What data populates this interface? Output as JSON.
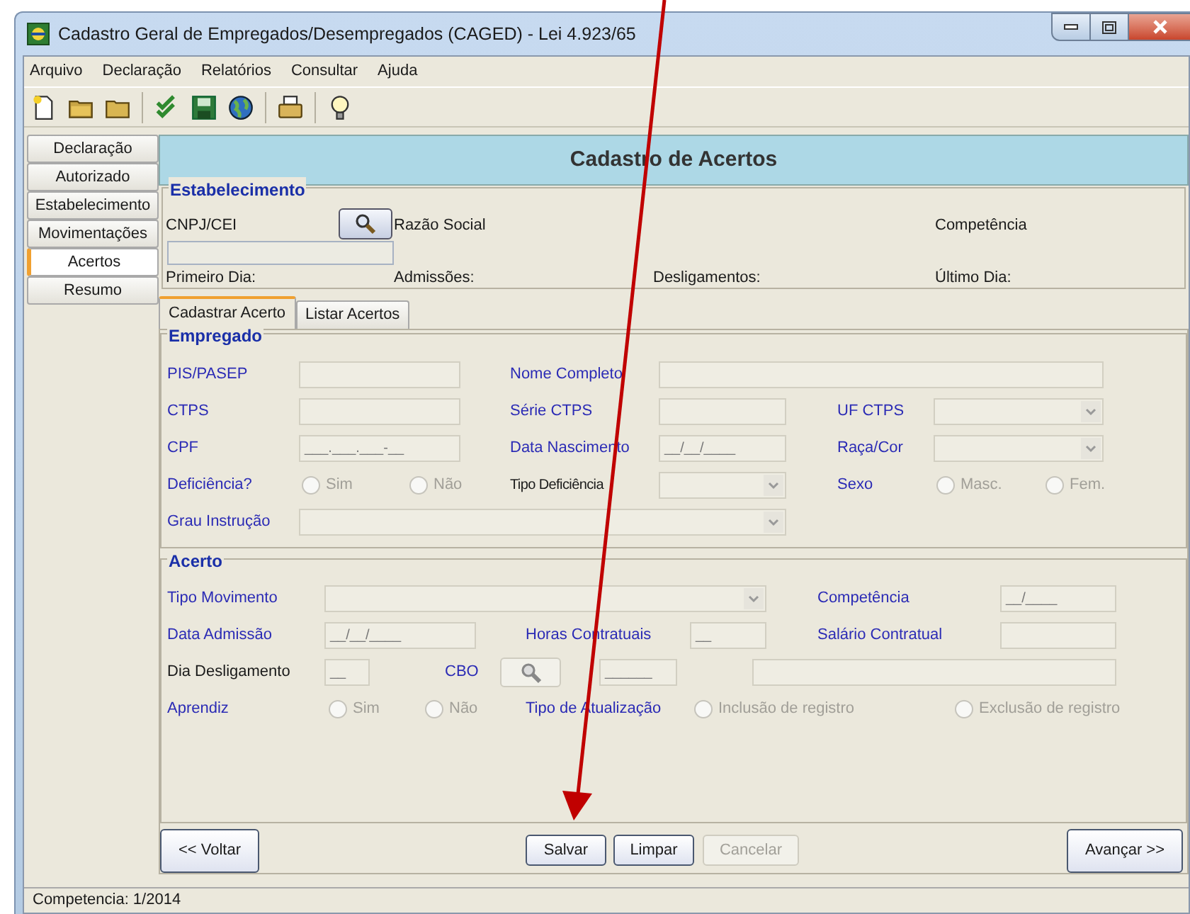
{
  "window": {
    "title": "Cadastro Geral de Empregados/Desempregados (CAGED) - Lei 4.923/65"
  },
  "menu": [
    "Arquivo",
    "Declaração",
    "Relatórios",
    "Consultar",
    "Ajuda"
  ],
  "sidebar": {
    "items": [
      {
        "label": "Declaração",
        "selected": false
      },
      {
        "label": "Autorizado",
        "selected": false
      },
      {
        "label": "Estabelecimento",
        "selected": false
      },
      {
        "label": "Movimentações",
        "selected": false
      },
      {
        "label": "Acertos",
        "selected": true
      },
      {
        "label": "Resumo",
        "selected": false
      }
    ]
  },
  "panel": {
    "title": "Cadastro de Acertos"
  },
  "estabelecimento": {
    "legend": "Estabelecimento",
    "cnpj_label": "CNPJ/CEI",
    "razao_social_label": "Razão Social",
    "competencia_label": "Competência",
    "primeiro_dia_label": "Primeiro Dia:",
    "admissoes_label": "Admissões:",
    "desligamentos_label": "Desligamentos:",
    "ultimo_dia_label": "Último Dia:"
  },
  "tabs": [
    {
      "label": "Cadastrar Acerto",
      "selected": true
    },
    {
      "label": "Listar Acertos",
      "selected": false
    }
  ],
  "empregado": {
    "legend": "Empregado",
    "lines": [
      {
        "fields": [
          {
            "label": "PIS/PASEP",
            "color": "#2b2bb5",
            "kind": "text"
          },
          {
            "label": "Nome Completo",
            "color": "#2b2bb5",
            "kind": "text"
          }
        ]
      },
      {
        "fields": [
          {
            "label": "CTPS",
            "color": "#2b2bb5",
            "kind": "text"
          },
          {
            "label": "Série CTPS",
            "color": "#2b2bb5",
            "kind": "text"
          },
          {
            "label": "UF CTPS",
            "color": "#2b2bb5",
            "kind": "combo"
          }
        ]
      },
      {
        "fields": [
          {
            "label": "CPF",
            "color": "#2b2bb5",
            "kind": "text",
            "value": "___.___.___-__"
          },
          {
            "label": "Data Nascimento",
            "color": "#2b2bb5",
            "kind": "text",
            "value": "__/__/____"
          },
          {
            "label": "Raça/Cor",
            "color": "#2b2bb5",
            "kind": "combo"
          }
        ]
      },
      {
        "fields": [
          {
            "label": "Deficiência?",
            "color": "#2b2bb5",
            "kind": "radio",
            "options": [
              {
                "text": "Sim",
                "checked": false
              },
              {
                "text": "Não",
                "checked": false
              }
            ]
          },
          {
            "label": "Tipo Deficiência",
            "color": "#1a1a1a",
            "kind": "combo"
          },
          {
            "label": "Sexo",
            "color": "#2b2bb5",
            "kind": "radio",
            "options": [
              {
                "text": "Masc.",
                "checked": false
              },
              {
                "text": "Fem.",
                "checked": false
              }
            ]
          }
        ]
      },
      {
        "fields": [
          {
            "label": "Grau Instrução",
            "color": "#2b2bb5",
            "kind": "combo"
          }
        ]
      }
    ]
  },
  "acerto": {
    "legend": "Acerto",
    "lines": [
      {
        "fields": [
          {
            "label": "Tipo Movimento",
            "color": "#2b2bb5",
            "kind": "combo"
          },
          {
            "label": "Competência",
            "color": "#2b2bb5",
            "kind": "text",
            "value": "__/____"
          }
        ]
      },
      {
        "fields": [
          {
            "label": "Data Admissão",
            "color": "#2b2bb5",
            "kind": "text",
            "value": "__/__/____"
          },
          {
            "label": "Horas Contratuais",
            "color": "#2b2bb5",
            "kind": "text",
            "value": "__"
          },
          {
            "label": "Salário Contratual",
            "color": "#2b2bb5",
            "kind": "text"
          }
        ]
      },
      {
        "fields": [
          {
            "label": "Dia Desligamento",
            "color": "#1a1a1a",
            "kind": "text",
            "value": "__"
          },
          {
            "label": "CBO",
            "color": "#2b2bb5",
            "kind": "lookup",
            "inputs": [
              "______"
            ],
            "description_input": true
          }
        ]
      },
      {
        "fields": [
          {
            "label": "Aprendiz",
            "color": "#2b2bb5",
            "kind": "radio",
            "options": [
              {
                "text": "Sim",
                "checked": false
              },
              {
                "text": "Não",
                "checked": false
              }
            ]
          },
          {
            "label": "Tipo de Atualização",
            "color": "#2b2bb5",
            "kind": "radio",
            "options": [
              {
                "text": "Inclusão de registro",
                "checked": false
              },
              {
                "text": "Exclusão de registro",
                "checked": false
              }
            ]
          }
        ]
      }
    ]
  },
  "buttons": [
    {
      "label": "<< Voltar",
      "disabled": false
    },
    {
      "label": "Salvar",
      "disabled": false
    },
    {
      "label": "Limpar",
      "disabled": false
    },
    {
      "label": "Cancelar",
      "disabled": true
    },
    {
      "label": "Avançar >>",
      "disabled": false
    }
  ],
  "status_bar": {
    "text": "Competencia: 1/2014"
  }
}
